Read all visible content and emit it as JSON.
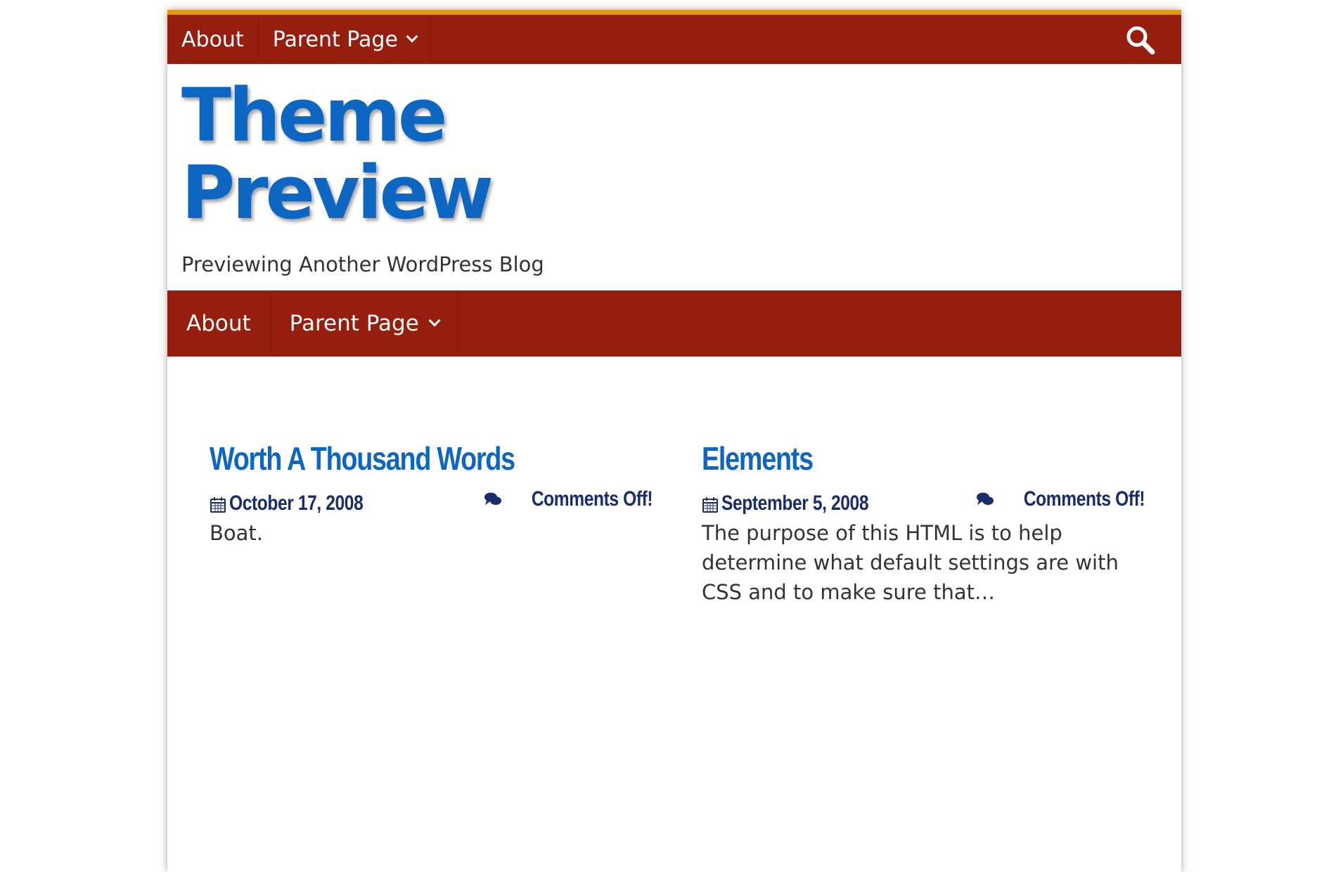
{
  "top_nav": {
    "items": [
      {
        "label": "About"
      },
      {
        "label": "Parent Page"
      }
    ],
    "search_icon": "search-icon"
  },
  "header": {
    "title_line1": "Theme",
    "title_line2": "Preview",
    "tagline": "Previewing Another WordPress Blog"
  },
  "main_nav": {
    "items": [
      {
        "label": "About"
      },
      {
        "label": "Parent Page"
      }
    ]
  },
  "posts": [
    {
      "title": "Worth A Thousand Words",
      "date": "October 17, 2008",
      "comments": "Comments Off!",
      "excerpt": "Boat."
    },
    {
      "title": "Elements",
      "date": "September 5, 2008",
      "comments": "Comments Off!",
      "excerpt": "The purpose of this HTML is to help determine what default settings are with CSS and to make sure that…"
    }
  ],
  "colors": {
    "nav_bg": "#961e0e",
    "accent_top": "#e49a10",
    "title_blue": "#0d66c2",
    "meta_navy": "#1a2d6b"
  }
}
